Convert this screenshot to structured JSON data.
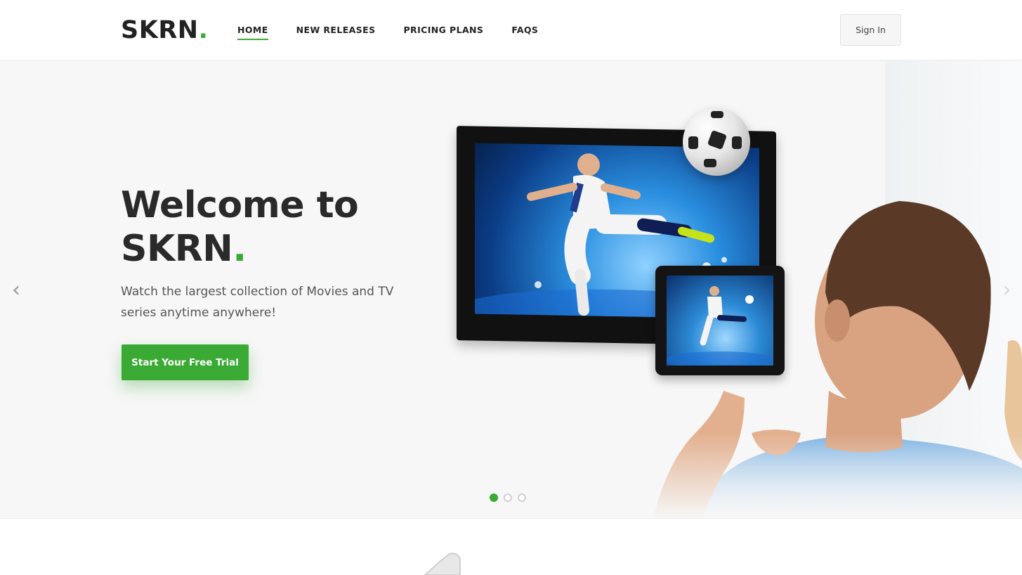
{
  "brand": {
    "name": "SKRN",
    "dot": ".",
    "accent": "#3aaa35"
  },
  "nav": {
    "items": [
      {
        "label": "HOME",
        "active": true
      },
      {
        "label": "NEW RELEASES",
        "active": false
      },
      {
        "label": "PRICING PLANS",
        "active": false
      },
      {
        "label": "FAQS",
        "active": false
      }
    ]
  },
  "header": {
    "signin_label": "Sign In"
  },
  "hero": {
    "title_line1": "Welcome to",
    "title_line2": "SKRN",
    "title_dot": ".",
    "subtitle": "Watch the largest collection of Movies and TV series anytime anywhere!",
    "cta_label": "Start Your Free Trial",
    "prev_icon": "chevron-left-icon",
    "next_icon": "chevron-right-icon",
    "slides": {
      "count": 3,
      "active_index": 0
    }
  }
}
